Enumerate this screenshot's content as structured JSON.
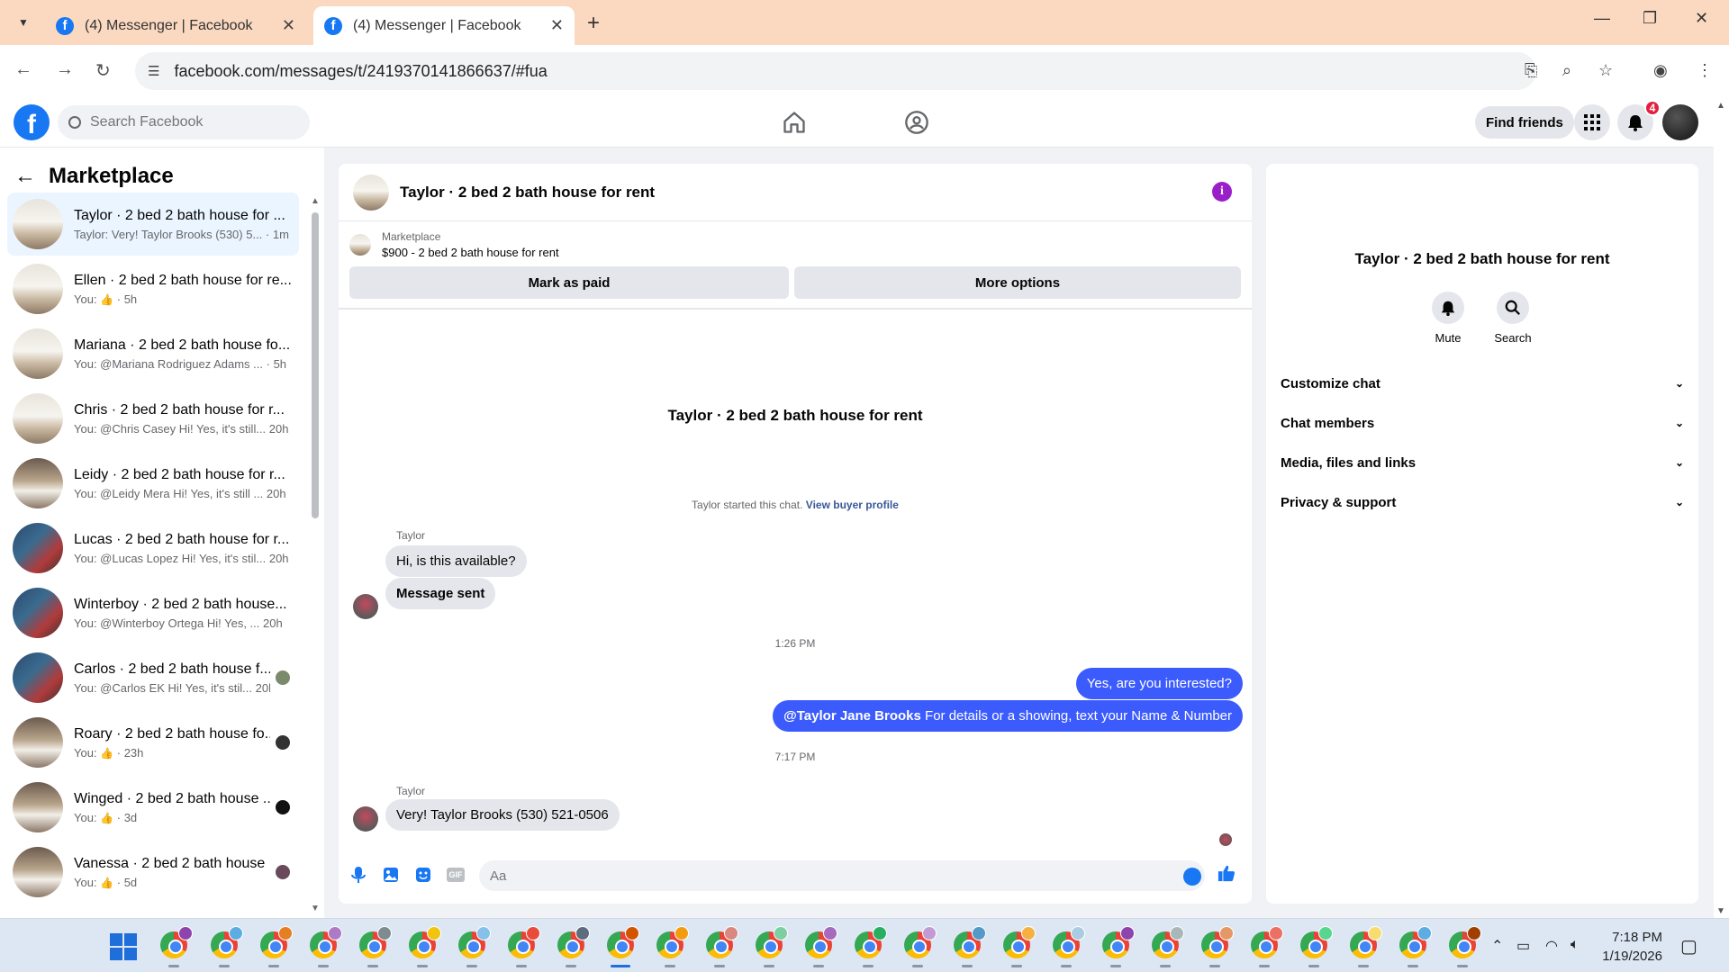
{
  "browser": {
    "tabs": [
      {
        "title": "(4) Messenger | Facebook"
      },
      {
        "title": "(4) Messenger | Facebook"
      }
    ],
    "url": "facebook.com/messages/t/2419370141866637/#fua"
  },
  "fb_header": {
    "search_placeholder": "Search Facebook",
    "find_friends_label": "Find friends",
    "notification_count": "4"
  },
  "sidebar": {
    "title": "Marketplace",
    "conversations": [
      {
        "name": "Taylor · 2 bed 2 bath house for ...",
        "sub": "Taylor: Very! Taylor Brooks (530) 5...",
        "time": "· 1m"
      },
      {
        "name": "Ellen · 2 bed 2 bath house for re...",
        "sub": "You:",
        "time": "· 5h"
      },
      {
        "name": "Mariana · 2 bed 2 bath house fo...",
        "sub": "You: @Mariana Rodriguez Adams ...",
        "time": "· 5h"
      },
      {
        "name": "Chris · 2 bed 2 bath house for r...",
        "sub": "You: @Chris Casey Hi! Yes, it's still...",
        "time": "20h"
      },
      {
        "name": "Leidy · 2 bed 2 bath house for r...",
        "sub": "You: @Leidy Mera Hi! Yes, it's still ...",
        "time": "20h"
      },
      {
        "name": "Lucas · 2 bed 2 bath house for r...",
        "sub": "You: @Lucas Lopez Hi! Yes, it's stil...",
        "time": "20h"
      },
      {
        "name": "Winterboy · 2 bed 2 bath house...",
        "sub": "You: @Winterboy Ortega Hi! Yes, ...",
        "time": "20h"
      },
      {
        "name": "Carlos · 2 bed 2 bath house f...",
        "sub": "You: @Carlos EK Hi! Yes, it's stil...",
        "time": "20h"
      },
      {
        "name": "Roary · 2 bed 2 bath house fo...",
        "sub": "You:",
        "time": "· 23h"
      },
      {
        "name": "Winged · 2 bed 2 bath house ...",
        "sub": "You:",
        "time": "· 3d"
      },
      {
        "name": "Vanessa · 2 bed 2 bath house ...",
        "sub": "You:",
        "time": "· 5d"
      }
    ]
  },
  "chat": {
    "title": "Taylor · 2 bed 2 bath house for rent",
    "marketplace_label": "Marketplace",
    "listing": "$900 - 2 bed 2 bath house for rent",
    "mark_paid": "Mark as paid",
    "more_options": "More options",
    "intro_name": "Taylor · 2 bed 2 bath house for rent",
    "started_text": "Taylor started this chat.",
    "view_profile": "View buyer profile",
    "sender": "Taylor",
    "msg1": "Hi, is this available?",
    "msg2": "Message sent",
    "time1": "1:26 PM",
    "out1": "Yes, are you interested?",
    "out2_mention": "@Taylor Jane Brooks",
    "out2_text": " For details or a showing, text your Name & Number",
    "time2": "7:17 PM",
    "sender2": "Taylor",
    "msg3": "Very! Taylor Brooks (530) 521-0506",
    "composer_placeholder": "Aa"
  },
  "right_panel": {
    "name": "Taylor · 2 bed 2 bath house for rent",
    "mute": "Mute",
    "search": "Search",
    "sections": [
      "Customize chat",
      "Chat members",
      "Media, files and links",
      "Privacy & support"
    ]
  },
  "taskbar": {
    "time": "7:18 PM",
    "date": "1/19/2026"
  },
  "colors": {
    "fb_blue": "#1877f2",
    "outgoing_bubble": "#3b5bfd",
    "tab_strip": "#fbd9c0"
  }
}
